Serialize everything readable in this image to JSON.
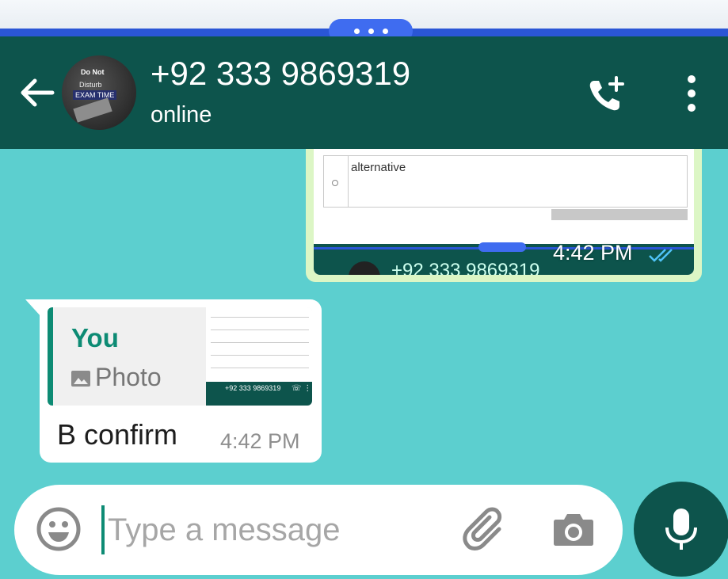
{
  "header": {
    "contact": "+92 333 9869319",
    "status": "online",
    "avatar_lines": [
      "Do Not",
      "Disturb",
      "EXAM TIME"
    ]
  },
  "messages": [
    {
      "type": "image",
      "direction": "outgoing",
      "image_text": "alternative",
      "image_header_text": "+92 333 9869319",
      "time": "4:42 PM",
      "ticks": "read-double-tick-icon"
    },
    {
      "type": "reply",
      "direction": "incoming",
      "quote": {
        "author": "You",
        "kind": "Photo",
        "thumb_title": "+92 333 9869319"
      },
      "text": "B confirm",
      "time": "4:42 PM"
    }
  ],
  "composer": {
    "placeholder": "Type a message"
  },
  "colors": {
    "header": "#0d544c",
    "accent": "#0d8b74",
    "chat_background": "#5ccfcf",
    "outgoing_bubble": "#dcf6c5",
    "system_bar": "#2a56d6"
  }
}
